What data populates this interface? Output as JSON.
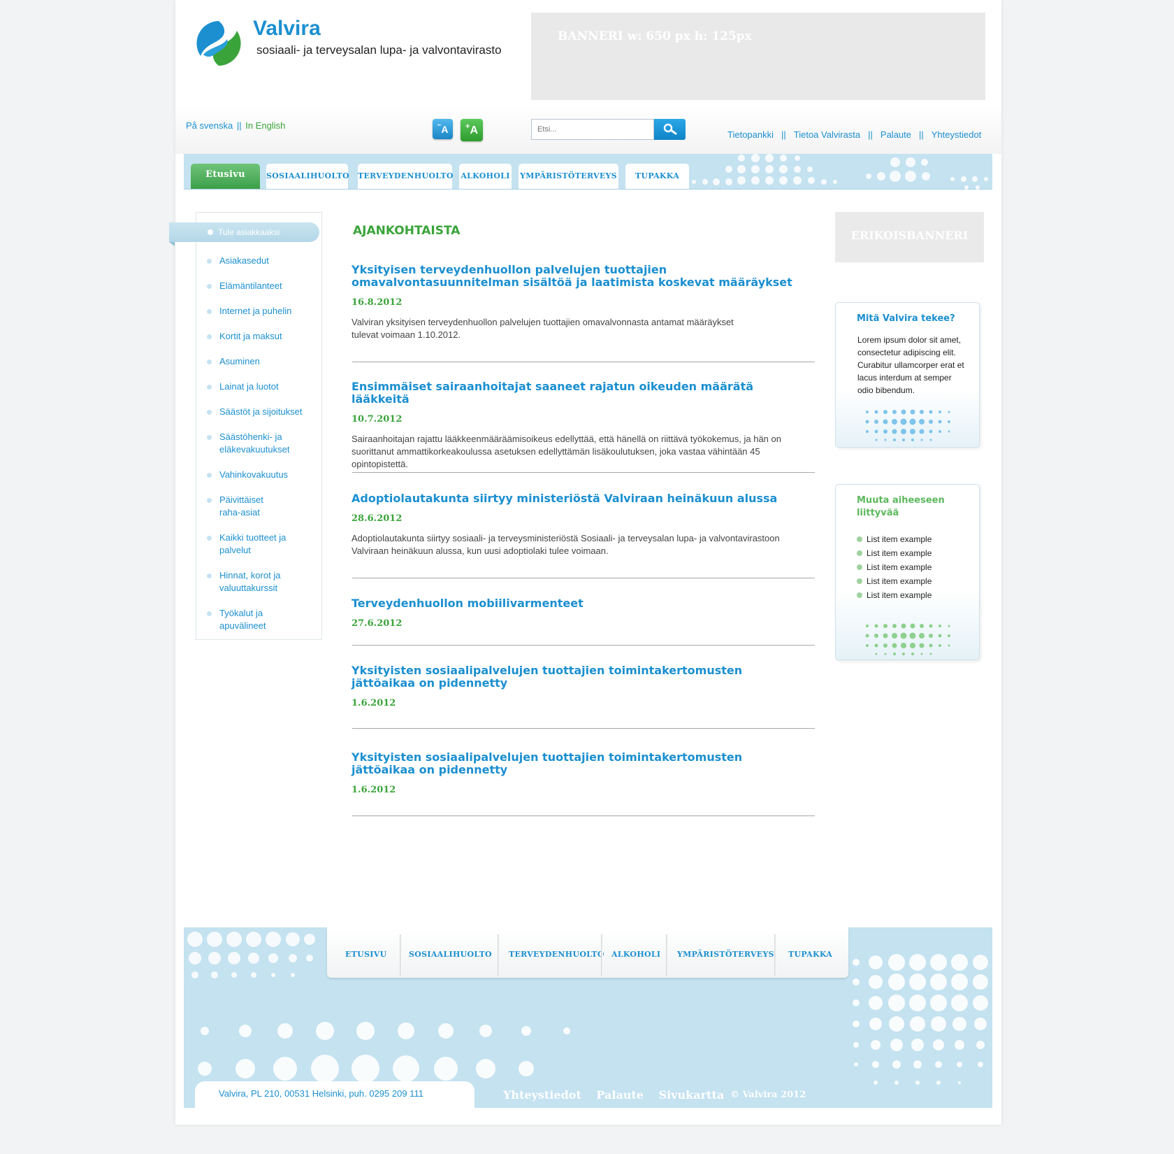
{
  "header": {
    "brand_name": "Valvira",
    "tagline": "sosiaali- ja terveysalan lupa- ja valvontavirasto",
    "banner_text": "BANNERI w: 650 px h: 125px"
  },
  "toolbar": {
    "lang_swedish": "På svenska",
    "lang_separator": "||",
    "lang_english": "In English",
    "font_decrease": "A",
    "font_increase": "A",
    "search_placeholder": "Etsi...",
    "util_links": [
      "Tietopankki",
      "Tietoa Valvirasta",
      "Palaute",
      "Yhteystiedot"
    ],
    "util_separator": "||"
  },
  "nav": {
    "tabs": [
      "Etusivu",
      "SOSIAALIHUOLTO",
      "TERVEYDENHUOLTO",
      "ALKOHOLI",
      "YMPÄRISTÖTERVEYS",
      "TUPAKKA"
    ]
  },
  "sidebar": {
    "active_item": "Tule asiakkaaksi",
    "items": [
      "Asiakasedut",
      "Elämäntilanteet",
      "Internet ja puhelin",
      "Kortit ja maksut",
      "Asuminen",
      "Lainat ja luotot",
      "Säästöt ja sijoitukset",
      "Säästöhenki- ja eläkevakuutukset",
      "Vahinkovakuutus",
      "Päivittäiset raha-asiat",
      "Kaikki tuotteet ja palvelut",
      "Hinnat, korot ja valuuttakurssit",
      "Työkalut ja apuvälineet"
    ]
  },
  "main": {
    "section_title": "AJANKOHTAISTA",
    "articles": [
      {
        "title": "Yksityisen terveydenhuollon palvelujen tuottajien omavalvontasuunnitelman sisältöä ja laatimista koskevat määräykset",
        "date": "16.8.2012",
        "body": "Valviran yksityisen terveydenhuollon palvelujen tuottajien omavalvonnasta antamat määräykset tulevat voimaan 1.10.2012."
      },
      {
        "title": "Ensimmäiset sairaanhoitajat saaneet rajatun oikeuden määrätä lääkkeitä",
        "date": "10.7.2012",
        "body": "Sairaanhoitajan rajattu lääkkeenmääräämisoikeus edellyttää, että hänellä on riittävä työkokemus, ja hän on suorittanut ammattikorkeakoulussa asetuksen edellyttämän lisäkoulutuksen, joka vastaa vähintään 45 opintopistettä."
      },
      {
        "title": "Adoptiolautakunta siirtyy ministeriöstä Valviraan heinäkuun alussa",
        "date": "28.6.2012",
        "body": "Adoptiolautakunta siirtyy sosiaali- ja terveysministeriöstä Sosiaali- ja terveysalan lupa- ja valvontavirastoon Valviraan heinäkuun alussa, kun uusi adoptiolaki tulee voimaan."
      },
      {
        "title": "Terveydenhuollon mobiilivarmenteet",
        "date": "27.6.2012",
        "body": ""
      },
      {
        "title": "Yksityisten sosiaalipalvelujen tuottajien toimintakertomusten jättöaikaa on pidennetty",
        "date": "1.6.2012",
        "body": ""
      },
      {
        "title": "Yksityisten sosiaalipalvelujen tuottajien toimintakertomusten jättöaikaa on pidennetty",
        "date": "1.6.2012",
        "body": ""
      }
    ]
  },
  "right": {
    "special_banner": "ERIKOISBANNERI",
    "box1": {
      "title": "Mitä Valvira tekee?",
      "text": "Lorem ipsum dolor sit amet, consectetur adipiscing elit. Curabitur ullamcorper erat et lacus interdum at semper odio bibendum."
    },
    "box2": {
      "title": "Muuta aiheeseen liittyvää",
      "items": [
        "List item example",
        "List item example",
        "List item example",
        "List item example",
        "List item example"
      ]
    }
  },
  "footer": {
    "nav": [
      "ETUSIVU",
      "SOSIAALIHUOLTO",
      "TERVEYDENHUOLTO",
      "ALKOHOLI",
      "YMPÄRISTÖTERVEYS",
      "TUPAKKA"
    ],
    "address": "Valvira, PL 210, 00531 Helsinki, puh. 0295 209 111",
    "links": [
      "Yhteystiedot",
      "Palaute",
      "Sivukartta"
    ],
    "copyright": "© Valvira 2012"
  },
  "colors": {
    "brand_blue": "#1b8fd0",
    "brand_green": "#3aa43a",
    "nav_background": "#c4e2f0"
  }
}
